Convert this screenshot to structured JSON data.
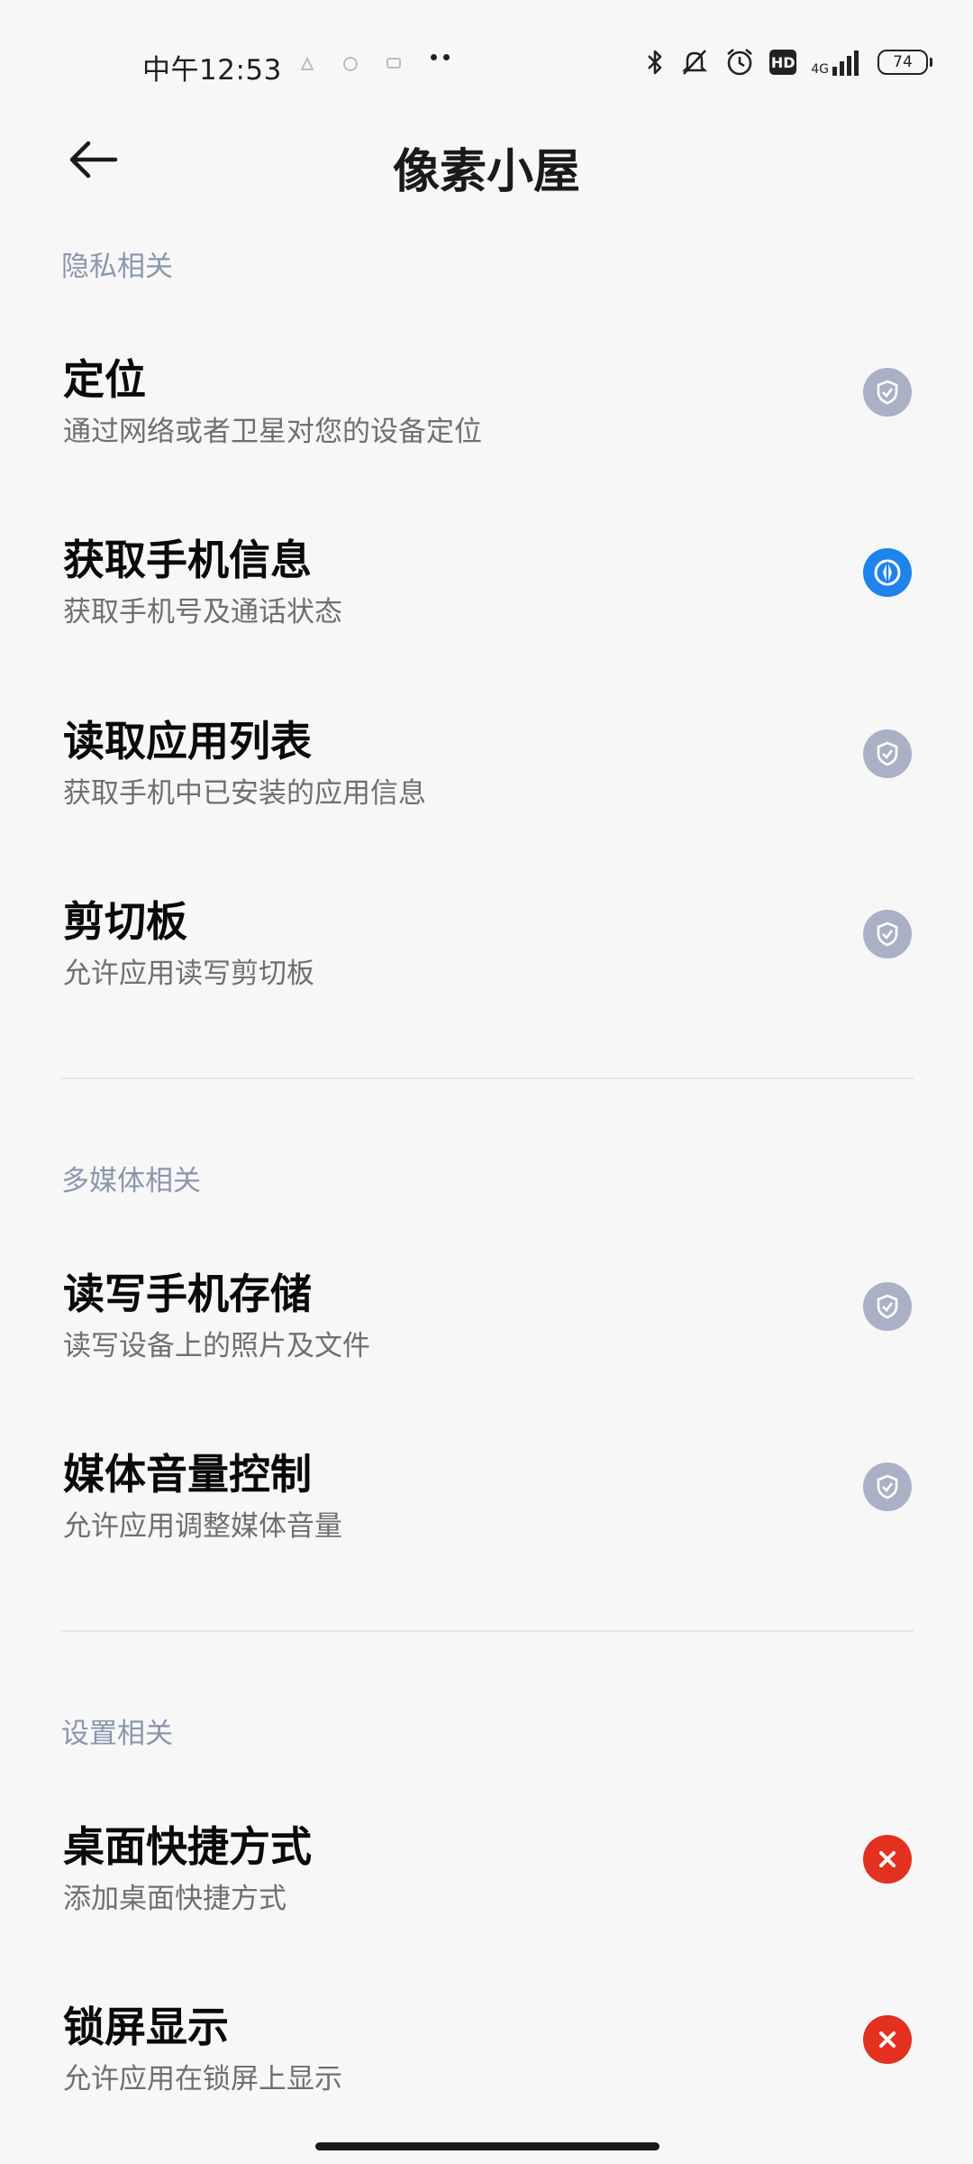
{
  "status_bar": {
    "time": "中午12:53",
    "network": "4G",
    "battery": "74",
    "icons": [
      "notification-icon",
      "cloud-icon",
      "message-icon",
      "more-dots-icon",
      "bluetooth-icon",
      "mute-icon",
      "alarm-icon",
      "hd-icon",
      "signal-icon",
      "battery-icon"
    ]
  },
  "header": {
    "title": "像素小屋",
    "back_icon": "arrow-left-icon"
  },
  "sections": [
    {
      "title": "隐私相关",
      "items": [
        {
          "title": "定位",
          "desc": "通过网络或者卫星对您的设备定位",
          "status": "granted"
        },
        {
          "title": "获取手机信息",
          "desc": "获取手机号及通话状态",
          "status": "asking"
        },
        {
          "title": "读取应用列表",
          "desc": "获取手机中已安装的应用信息",
          "status": "granted"
        },
        {
          "title": "剪切板",
          "desc": "允许应用读写剪切板",
          "status": "granted"
        }
      ]
    },
    {
      "title": "多媒体相关",
      "items": [
        {
          "title": "读写手机存储",
          "desc": "读写设备上的照片及文件",
          "status": "granted"
        },
        {
          "title": "媒体音量控制",
          "desc": "允许应用调整媒体音量",
          "status": "granted"
        }
      ]
    },
    {
      "title": "设置相关",
      "items": [
        {
          "title": "桌面快捷方式",
          "desc": "添加桌面快捷方式",
          "status": "denied"
        },
        {
          "title": "锁屏显示",
          "desc": "允许应用在锁屏上显示",
          "status": "denied"
        }
      ]
    }
  ],
  "colors": {
    "granted": "#aab1c5",
    "asking": "#1f83ec",
    "denied": "#e3301f",
    "section_header": "#8a97ad"
  }
}
